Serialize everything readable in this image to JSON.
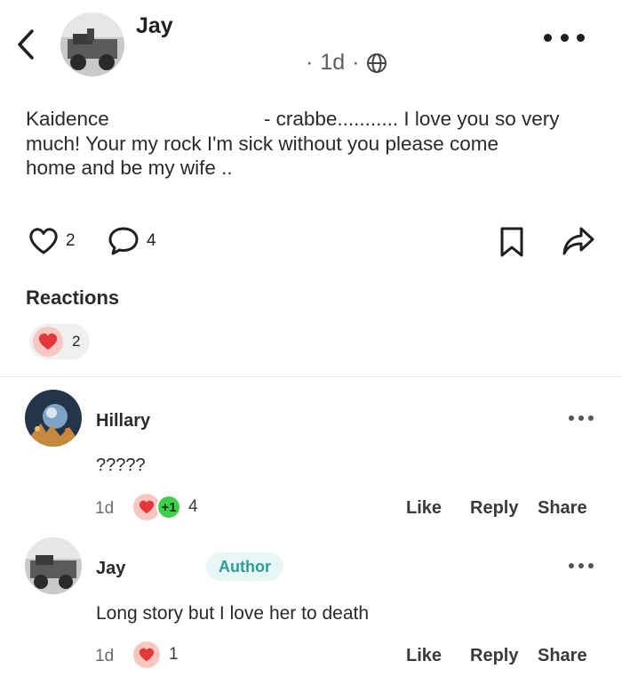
{
  "post": {
    "author": "Jay",
    "time": "1d",
    "separator": "·",
    "text_prefix": "Kaidence",
    "text_rest": "- crabbe........... I love you so very",
    "text_lines": [
      "much! Your my rock I'm sick without you please come",
      "home and be my wife .."
    ],
    "likes": "2",
    "comments": "4",
    "icons": [
      "back-chevron-icon",
      "globe-icon",
      "more-dots-icon",
      "heart-outline-icon",
      "comment-bubble-icon",
      "bookmark-icon",
      "share-arrow-icon"
    ]
  },
  "reactions": {
    "title": "Reactions",
    "heart_count": "2"
  },
  "comments": [
    {
      "name": "Hillary",
      "body": "?????",
      "time": "1d",
      "plus": "+1",
      "reaction_count": "4",
      "like": "Like",
      "reply": "Reply",
      "share": "Share"
    },
    {
      "name": "Jay",
      "badge": "Author",
      "body": "Long story but I love her to death",
      "time": "1d",
      "reaction_count": "1",
      "like": "Like",
      "reply": "Reply",
      "share": "Share"
    }
  ],
  "colors": {
    "heart": "#e5373a",
    "heart_bg": "#f9c7c2",
    "author_badge": "#2d9c95",
    "plus_one": "#3fcf4b"
  }
}
